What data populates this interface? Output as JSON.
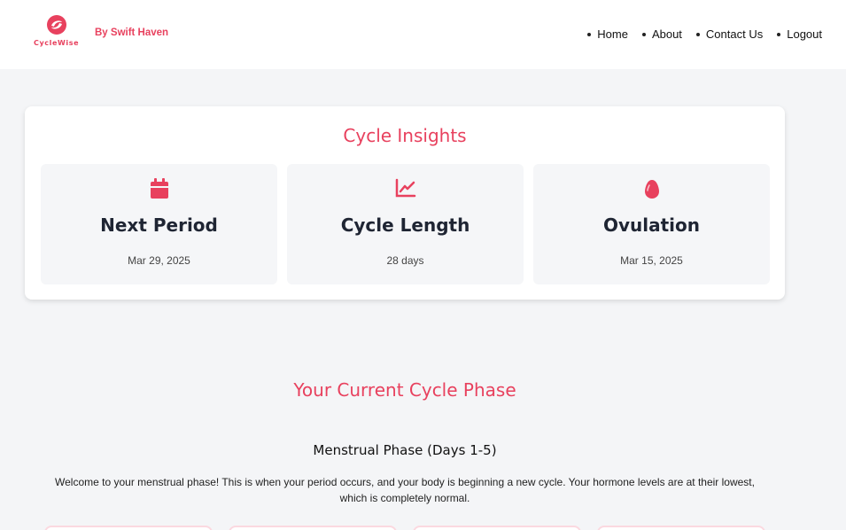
{
  "header": {
    "logo_text": "CycleWise",
    "byline": "By Swift Haven",
    "nav": [
      {
        "label": "Home"
      },
      {
        "label": "About"
      },
      {
        "label": "Contact Us"
      },
      {
        "label": "Logout"
      }
    ]
  },
  "insights": {
    "title": "Cycle Insights",
    "tiles": [
      {
        "icon": "calendar-icon",
        "label": "Next Period",
        "value": "Mar 29, 2025"
      },
      {
        "icon": "chart-line-icon",
        "label": "Cycle Length",
        "value": "28 days"
      },
      {
        "icon": "egg-icon",
        "label": "Ovulation",
        "value": "Mar 15, 2025"
      }
    ]
  },
  "phase": {
    "title": "Your Current Cycle Phase",
    "name": "Menstrual Phase (Days 1-5)",
    "description": "Welcome to your menstrual phase! This is when your period occurs, and your body is beginning a new cycle. Your hormone levels are at their lowest, which is completely normal."
  },
  "colors": {
    "accent": "#e8415e",
    "tile_bg": "#f5f6f8",
    "page_bg": "#f4f5f7"
  }
}
